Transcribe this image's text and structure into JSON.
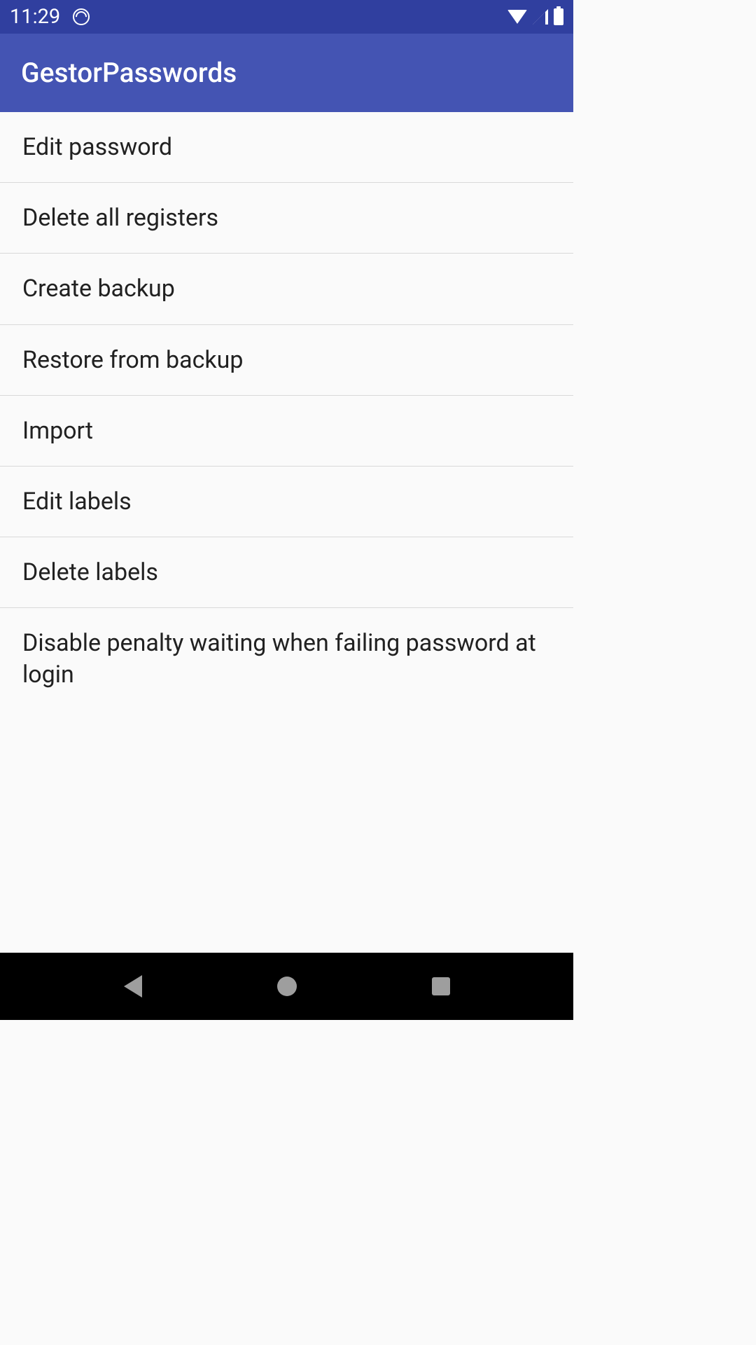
{
  "statusBar": {
    "time": "11:29"
  },
  "appBar": {
    "title": "GestorPasswords"
  },
  "menuItems": [
    {
      "label": "Edit password"
    },
    {
      "label": "Delete all registers"
    },
    {
      "label": "Create backup"
    },
    {
      "label": "Restore from backup"
    },
    {
      "label": "Import"
    },
    {
      "label": "Edit labels"
    },
    {
      "label": "Delete labels"
    },
    {
      "label": "Disable penalty waiting when failing password at login"
    }
  ]
}
